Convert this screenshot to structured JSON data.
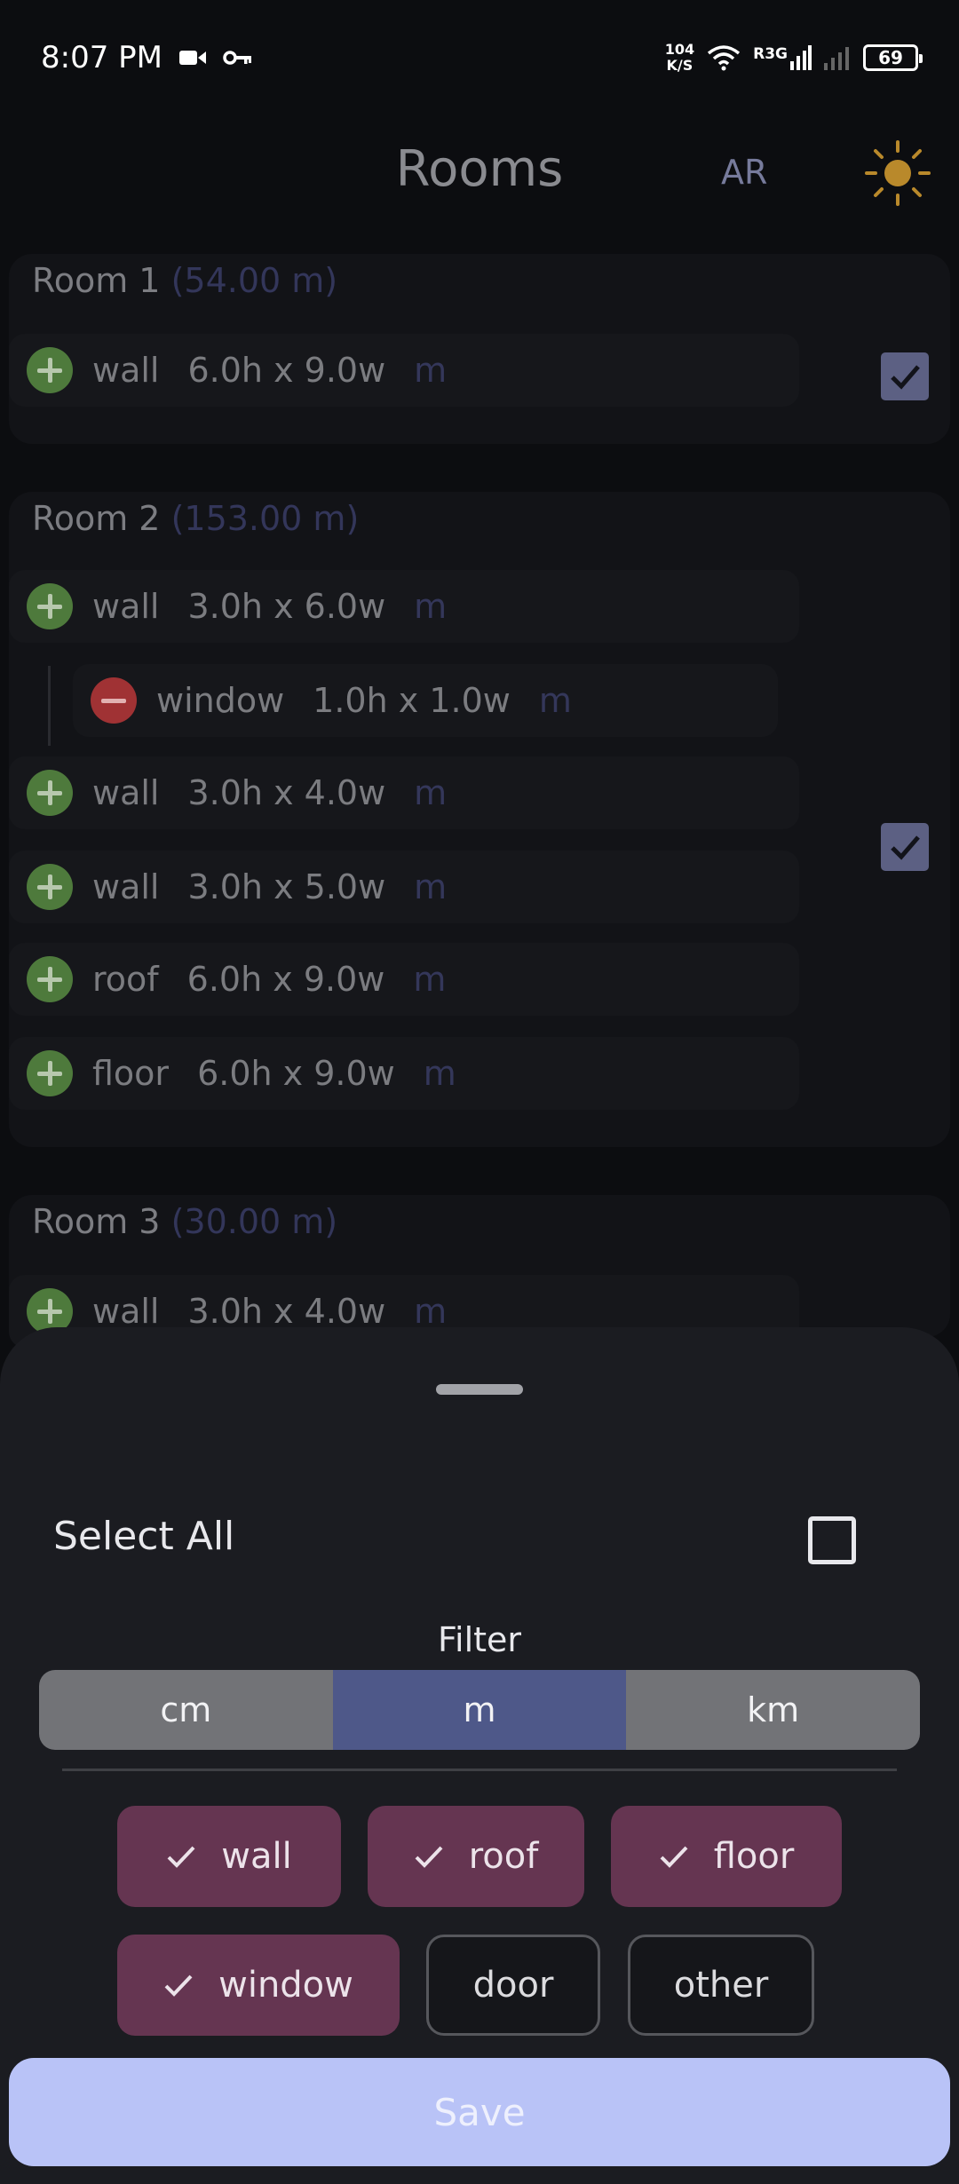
{
  "status_bar": {
    "time": "8:07 PM",
    "net_speed_value": "104",
    "net_speed_unit": "K/S",
    "carrier": "R3G",
    "battery": "69",
    "icons": [
      "video-icon",
      "key-icon",
      "wifi-icon",
      "signal-icon",
      "signal-weak-icon",
      "battery-icon"
    ]
  },
  "header": {
    "title": "Rooms",
    "ar_label": "AR",
    "theme_icon": "sun-icon"
  },
  "rooms": [
    {
      "name": "Room 1",
      "area": "(54.00 m)",
      "checked": true,
      "items": [
        {
          "type": "wall",
          "dims": "6.0h x 9.0w",
          "unit": "m"
        }
      ]
    },
    {
      "name": "Room 2",
      "area": "(153.00 m)",
      "checked": true,
      "items": [
        {
          "type": "wall",
          "dims": "3.0h x 6.0w",
          "unit": "m"
        },
        {
          "type": "window",
          "dims": "1.0h x 1.0w",
          "unit": "m"
        },
        {
          "type": "wall",
          "dims": "3.0h x 4.0w",
          "unit": "m"
        },
        {
          "type": "wall",
          "dims": "3.0h x 5.0w",
          "unit": "m"
        },
        {
          "type": "roof",
          "dims": "6.0h x 9.0w",
          "unit": "m"
        },
        {
          "type": "floor",
          "dims": "6.0h x 9.0w",
          "unit": "m"
        }
      ]
    },
    {
      "name": "Room 3",
      "area": "(30.00 m)",
      "items": [
        {
          "type": "wall",
          "dims": "3.0h x 4.0w",
          "unit": "m"
        }
      ]
    }
  ],
  "sheet": {
    "select_all_label": "Select All",
    "select_all_checked": false,
    "filter_label": "Filter",
    "units": [
      {
        "label": "cm",
        "selected": false
      },
      {
        "label": "m",
        "selected": true
      },
      {
        "label": "km",
        "selected": false
      }
    ],
    "chips": [
      {
        "label": "wall",
        "selected": true
      },
      {
        "label": "roof",
        "selected": true
      },
      {
        "label": "floor",
        "selected": true
      },
      {
        "label": "window",
        "selected": true
      },
      {
        "label": "door",
        "selected": false
      },
      {
        "label": "other",
        "selected": false
      }
    ],
    "save_label": "Save"
  },
  "colors": {
    "background": "#0c0d10",
    "add_icon": "#4e7a3c",
    "remove_icon": "#a03234",
    "selected_segment": "#4e5889",
    "selected_chip": "#653551",
    "save_button": "#b9c3f7"
  }
}
